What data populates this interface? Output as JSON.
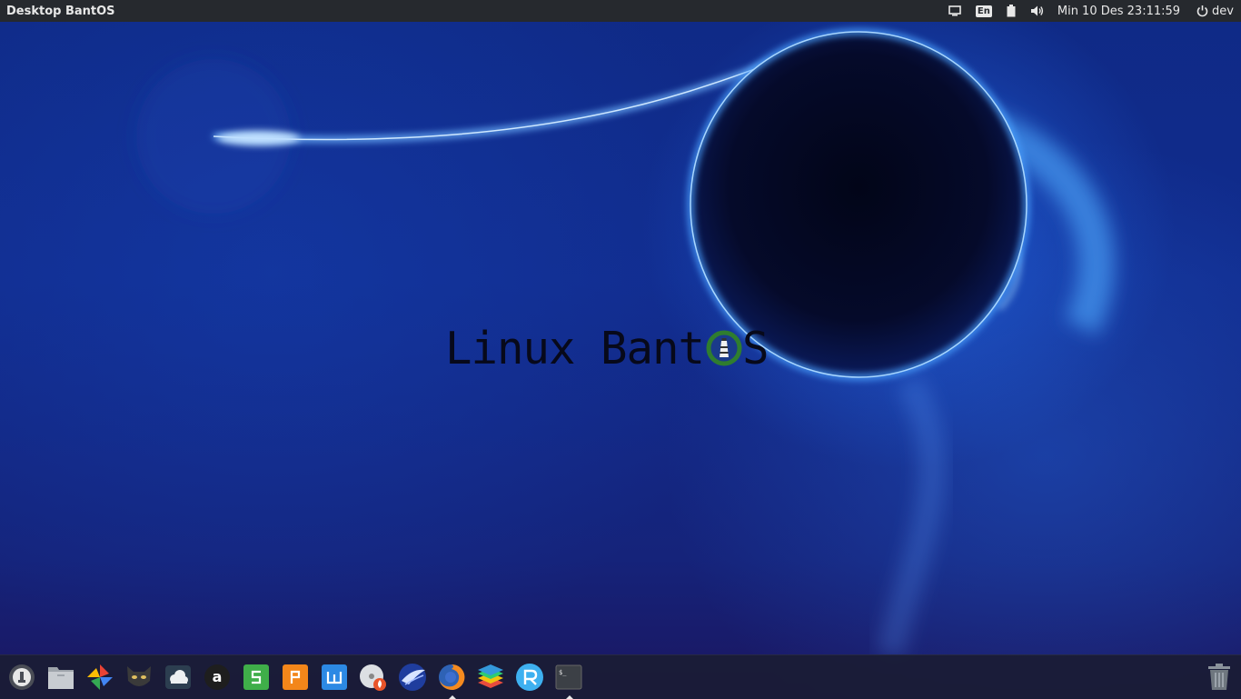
{
  "panel": {
    "title": "Desktop BantOS",
    "language": "En",
    "clock": "Min 10 Des 23:11:59",
    "user": "dev",
    "icons": [
      "display-icon",
      "keyboard-language-icon",
      "battery-icon",
      "volume-icon",
      "power-icon"
    ]
  },
  "logo": {
    "text_before": "Linux Bant",
    "text_after": "S"
  },
  "dock": {
    "items": [
      "launcher-icon",
      "files-icon",
      "photos-icon",
      "cat-app-icon",
      "cloud-icon",
      "a-app-icon",
      "spreadsheet-icon",
      "presentation-icon",
      "writer-icon",
      "disc-burner-icon",
      "bird-browser-icon",
      "firefox-icon",
      "layers-icon",
      "r-app-icon",
      "terminal-icon",
      "trash-icon"
    ]
  },
  "colors": {
    "panel_bg": "#26292e",
    "dock_bg": "#1a1c34",
    "wallpaper_blue": "#112c8e",
    "glow": "#4aa0ff"
  }
}
